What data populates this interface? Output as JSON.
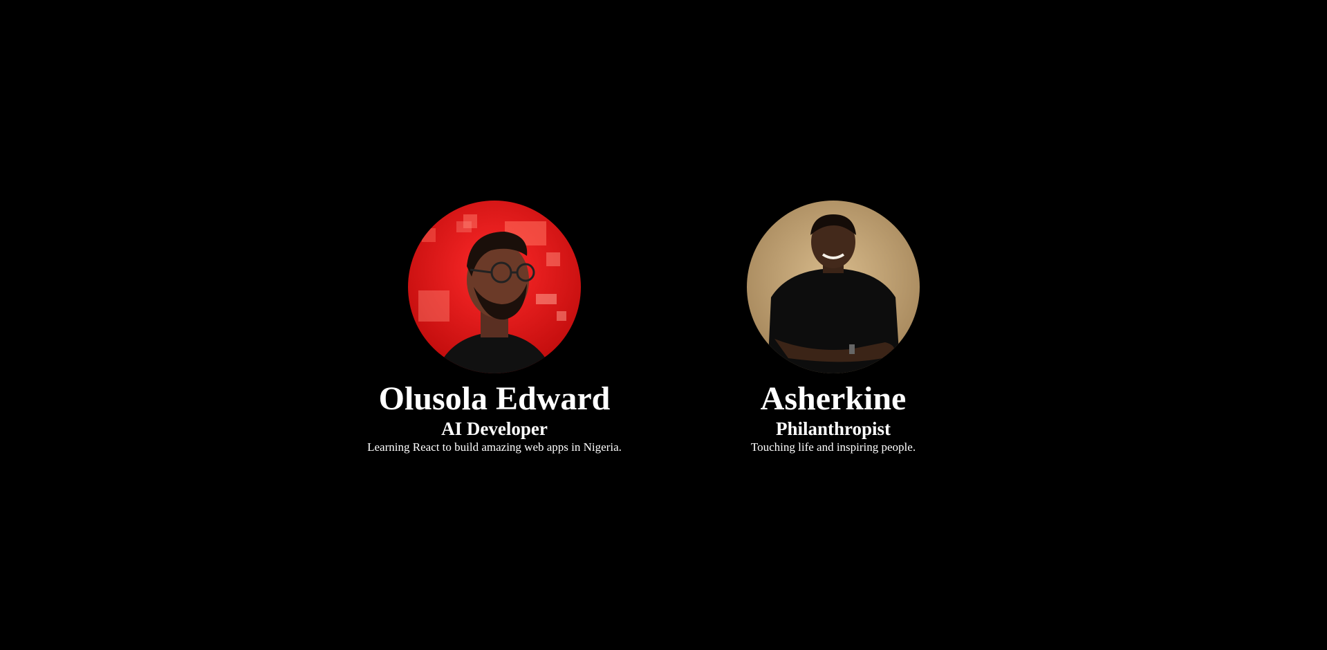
{
  "profiles": [
    {
      "name": "Olusola Edward",
      "role": "AI Developer",
      "bio": "Learning React to build amazing web apps in Nigeria.",
      "avatar_icon": "person-photo-icon",
      "avatar_bg": "#d91414"
    },
    {
      "name": "Asherkine",
      "role": "Philanthropist",
      "bio": "Touching life and inspiring people.",
      "avatar_icon": "person-photo-icon",
      "avatar_bg": "#b8986a"
    }
  ]
}
